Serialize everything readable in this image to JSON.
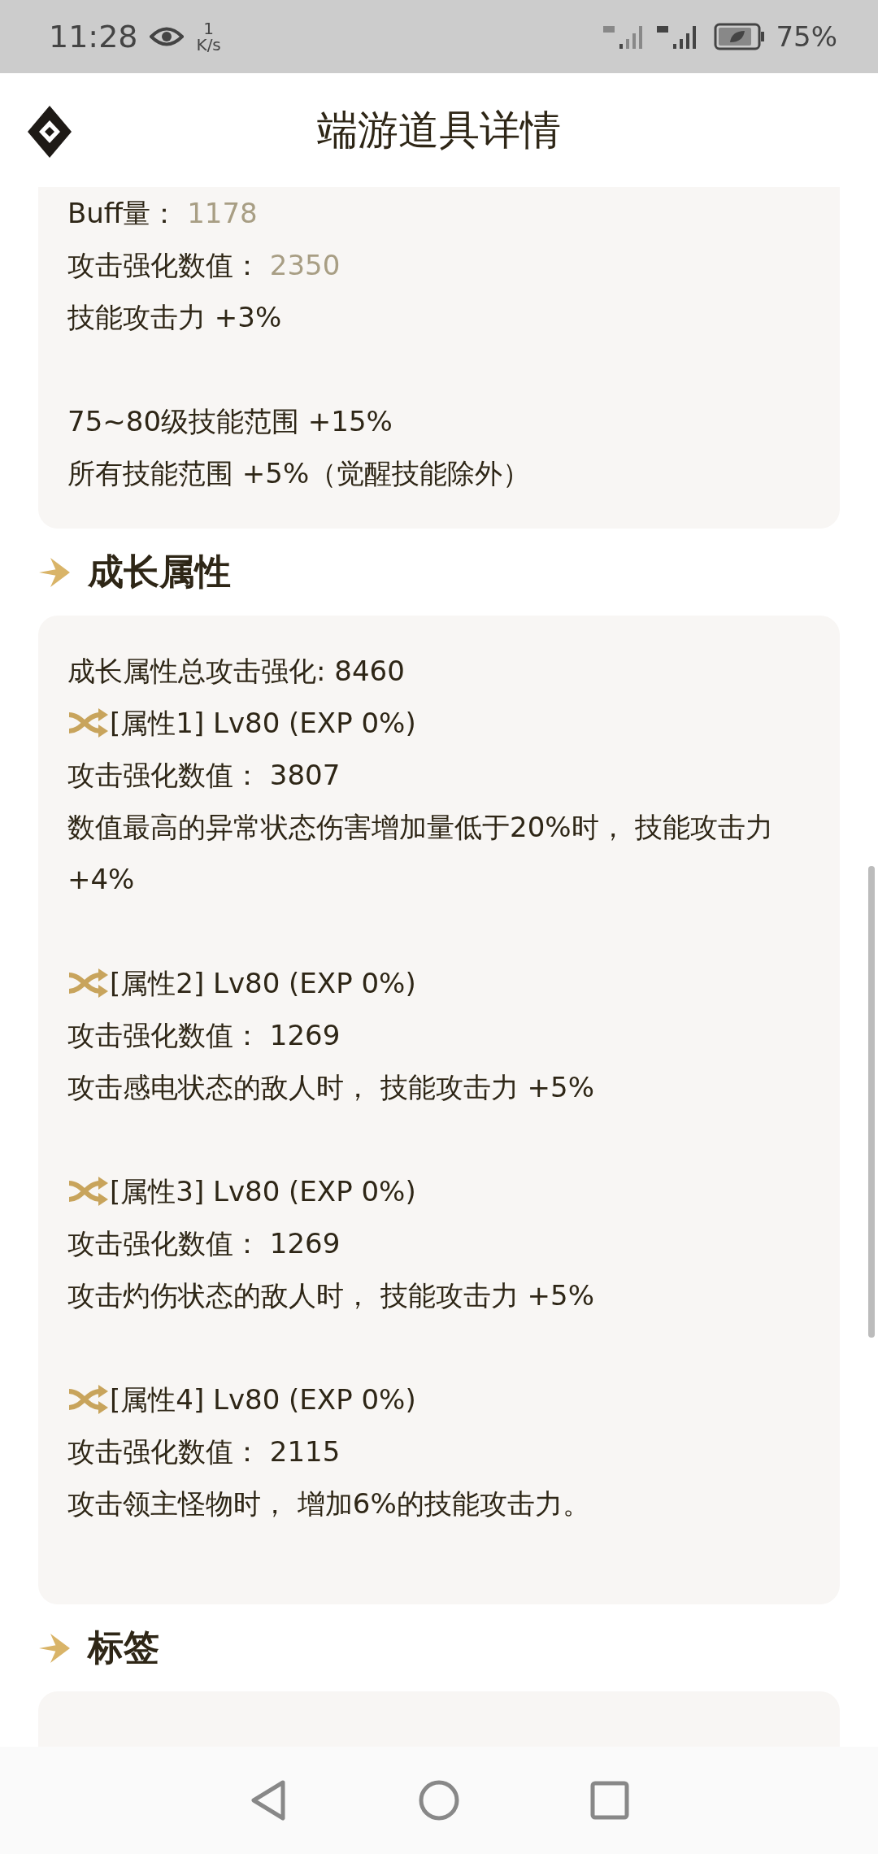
{
  "status_bar": {
    "time": "11:28",
    "speed_value": "1",
    "speed_unit": "K/s",
    "battery": "75%"
  },
  "header": {
    "title": "端游道具详情"
  },
  "sections": [
    {
      "paragraphs": [
        [
          {
            "kind": "stat",
            "label": "Buff量：",
            "value": "1178",
            "highlight": true
          },
          {
            "kind": "stat",
            "label": "攻击强化数值：",
            "value": "2350",
            "highlight": true
          },
          {
            "kind": "text",
            "text": "技能攻击力 +3%"
          }
        ],
        [
          {
            "kind": "text",
            "text": "75~80级技能范围 +15%"
          },
          {
            "kind": "text",
            "text": "所有技能范围 +5%（觉醒技能除外）"
          }
        ]
      ]
    },
    {
      "heading": "成长属性",
      "paragraphs": [
        [
          {
            "kind": "text",
            "text": "成长属性总攻击强化: 8460"
          },
          {
            "kind": "attr",
            "text": "[属性1] Lv80 (EXP 0%)"
          },
          {
            "kind": "stat",
            "label": "攻击强化数值：",
            "value": "3807",
            "highlight": false
          },
          {
            "kind": "text",
            "text": "数值最高的异常状态伤害增加量低于20%时， 技能攻击力 +4%"
          }
        ],
        [
          {
            "kind": "attr",
            "text": "[属性2] Lv80 (EXP 0%)"
          },
          {
            "kind": "stat",
            "label": "攻击强化数值：",
            "value": "1269",
            "highlight": false
          },
          {
            "kind": "text",
            "text": "攻击感电状态的敌人时， 技能攻击力 +5%"
          }
        ],
        [
          {
            "kind": "attr",
            "text": "[属性3] Lv80 (EXP 0%)"
          },
          {
            "kind": "stat",
            "label": "攻击强化数值：",
            "value": "1269",
            "highlight": false
          },
          {
            "kind": "text",
            "text": "攻击灼伤状态的敌人时， 技能攻击力 +5%"
          }
        ],
        [
          {
            "kind": "attr",
            "text": "[属性4] Lv80 (EXP 0%)"
          },
          {
            "kind": "stat",
            "label": "攻击强化数值：",
            "value": "2115",
            "highlight": false
          },
          {
            "kind": "text",
            "text": "攻击领主怪物时， 增加6%的技能攻击力。"
          }
        ]
      ]
    },
    {
      "heading": "标签"
    }
  ]
}
